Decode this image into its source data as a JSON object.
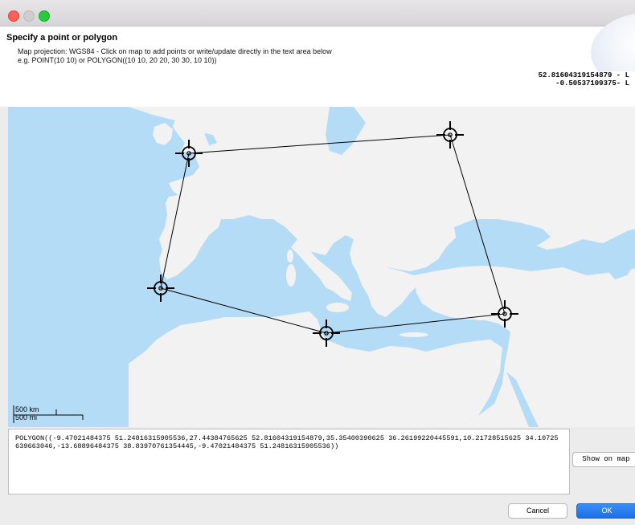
{
  "window": {
    "controls": {
      "close": "close-icon",
      "minimize": "minimize-icon",
      "zoom": "zoom-icon"
    }
  },
  "header": {
    "title": "Specify a point or polygon",
    "desc_line1": "Map projection: WGS84 - Click on map to add points or write/update directly in the text area below",
    "desc_line2": "e.g. POINT(10 10) or POLYGON((10 10, 20 20, 30 30, 10 10))"
  },
  "coords": {
    "line1": "52.81604319154879 - L",
    "line2": "-0.50537109375- L"
  },
  "scale": {
    "km": "500 km",
    "mi": "500 mi"
  },
  "wkt_text": "POLYGON((-9.47021484375 51.24816315905536,27.44384765625 52.81604319154879,35.35400390625 36.26199220445591,10.21728515625 34.10725639663046,-13.68896484375 38.83970761354445,-9.47021484375 51.24816315905536))",
  "buttons": {
    "show_on_map": "Show on map",
    "cancel": "Cancel",
    "ok": "OK"
  },
  "colors": {
    "sea": "#b5dcf6",
    "land": "#f2f2f2",
    "accent": "#1a6fea"
  }
}
